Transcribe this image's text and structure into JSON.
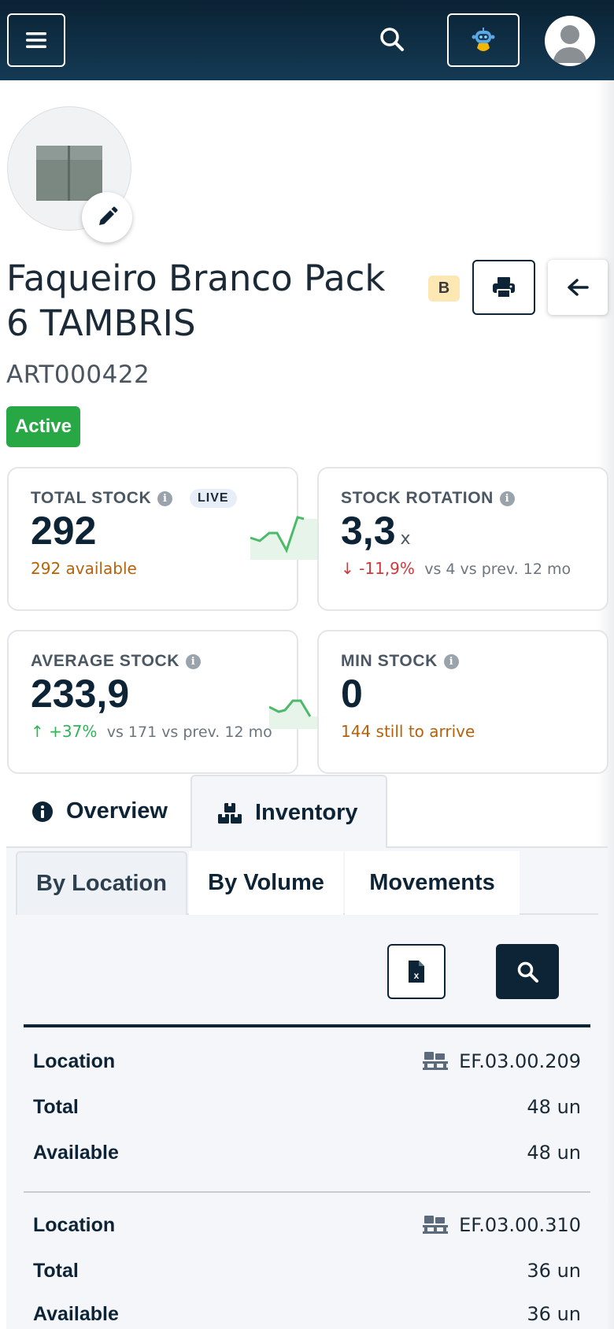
{
  "product": {
    "title": "Faqueiro Branco Pack 6 TAMBRIS",
    "class_badge": "B",
    "code": "ART000422",
    "status": "Active"
  },
  "kpis": {
    "total_stock": {
      "label": "TOTAL STOCK",
      "badge": "LIVE",
      "value": "292",
      "sub": "292 available"
    },
    "stock_rotation": {
      "label": "STOCK ROTATION",
      "value": "3,3",
      "unit": "x",
      "change": "-11,9%",
      "compare": "vs 4 vs prev. 12 mo"
    },
    "average_stock": {
      "label": "AVERAGE STOCK",
      "value": "233,9",
      "change": "+37%",
      "compare": "vs 171 vs prev. 12 mo"
    },
    "min_stock": {
      "label": "MIN STOCK",
      "value": "0",
      "sub": "144 still to arrive"
    }
  },
  "tabs": {
    "overview": "Overview",
    "inventory": "Inventory"
  },
  "subtabs": {
    "by_location": "By Location",
    "by_volume": "By Volume",
    "movements": "Movements"
  },
  "records": [
    {
      "location_label": "Location",
      "location": "EF.03.00.209",
      "total_label": "Total",
      "total": "48 un",
      "available_label": "Available",
      "available": "48 un"
    },
    {
      "location_label": "Location",
      "location": "EF.03.00.310",
      "total_label": "Total",
      "total": "36 un",
      "available_label": "Available",
      "available": "36 un"
    }
  ],
  "colors": {
    "header": "#0a2233",
    "accent": "#0d2436",
    "status_active": "#28a745",
    "warning_text": "#b5620b",
    "negative": "#d0383c",
    "positive": "#2fb457"
  },
  "icons": [
    "menu-icon",
    "search-icon",
    "assistant-robot-icon",
    "user-avatar-icon",
    "pencil-icon",
    "printer-icon",
    "arrow-left-icon",
    "info-icon",
    "boxes-icon",
    "excel-file-icon",
    "pallet-icon"
  ]
}
